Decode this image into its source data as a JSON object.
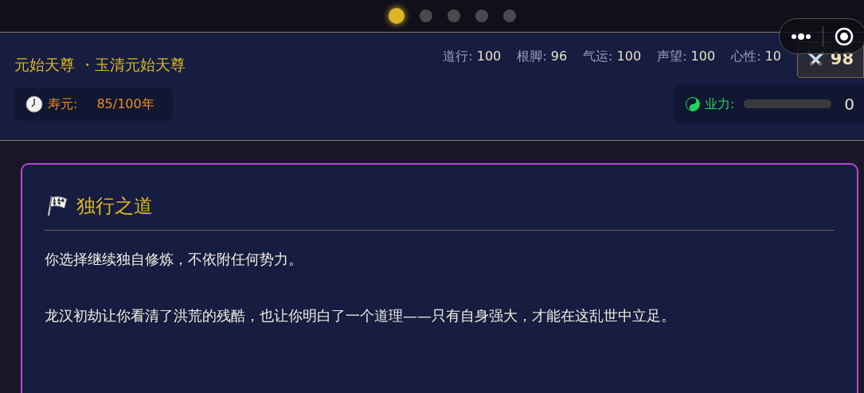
{
  "pager": [
    {
      "selected": true
    },
    {
      "selected": false
    },
    {
      "selected": false
    },
    {
      "selected": false
    },
    {
      "selected": false
    }
  ],
  "header": {
    "title": "元始天尊 ・玉清元始天尊",
    "stats": [
      {
        "label": "道行:",
        "value": "100"
      },
      {
        "label": "根脚:",
        "value": "96"
      },
      {
        "label": "气运:",
        "value": "100"
      },
      {
        "label": "声望:",
        "value": "100"
      },
      {
        "label": "心性:",
        "value": "10"
      }
    ],
    "power": "98",
    "lifespan": {
      "label": "寿元:",
      "value": "85/100年"
    },
    "karma": {
      "label": "业力:",
      "level": 0,
      "value": "0"
    }
  },
  "card": {
    "title": "独行之道",
    "paragraphs": [
      "你选择继续独自修炼，不依附任何势力。",
      "龙汉初劫让你看清了洪荒的残酷，也让你明白了一个道理——只有自身强大，才能在这乱世中立足。"
    ]
  }
}
